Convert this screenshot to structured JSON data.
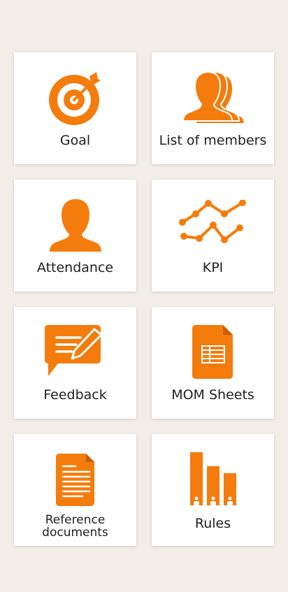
{
  "accent_color": "#f47c0c",
  "tiles": [
    {
      "label": "Goal",
      "icon": "target-icon"
    },
    {
      "label": "List of members",
      "icon": "members-icon"
    },
    {
      "label": "Attendance",
      "icon": "person-icon"
    },
    {
      "label": "KPI",
      "icon": "line-chart-icon"
    },
    {
      "label": "Feedback",
      "icon": "feedback-icon"
    },
    {
      "label": "MOM Sheets",
      "icon": "spreadsheet-icon"
    },
    {
      "label": "Reference documents",
      "icon": "document-icon"
    },
    {
      "label": "Rules",
      "icon": "bar-chart-icon"
    }
  ]
}
